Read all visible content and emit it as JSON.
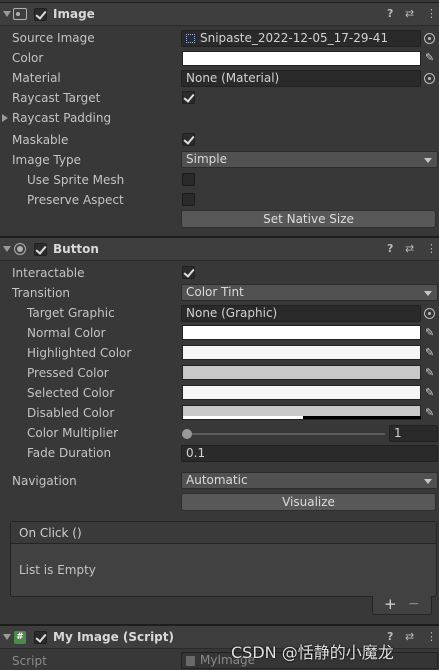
{
  "image_component": {
    "title": "Image",
    "props": {
      "source_image_label": "Source Image",
      "source_image_value": "Snipaste_2022-12-05_17-29-41",
      "color_label": "Color",
      "material_label": "Material",
      "material_value": "None (Material)",
      "raycast_target_label": "Raycast Target",
      "raycast_padding_label": "Raycast Padding",
      "maskable_label": "Maskable",
      "image_type_label": "Image Type",
      "image_type_value": "Simple",
      "use_sprite_mesh_label": "Use Sprite Mesh",
      "preserve_aspect_label": "Preserve Aspect",
      "set_native_size_label": "Set Native Size"
    },
    "raycast_target_checked": true,
    "maskable_checked": true,
    "use_sprite_mesh_checked": false,
    "preserve_aspect_checked": false,
    "color": "#ffffff"
  },
  "button_component": {
    "title": "Button",
    "props": {
      "interactable_label": "Interactable",
      "transition_label": "Transition",
      "transition_value": "Color Tint",
      "target_graphic_label": "Target Graphic",
      "target_graphic_value": "None (Graphic)",
      "normal_color_label": "Normal Color",
      "highlighted_color_label": "Highlighted Color",
      "pressed_color_label": "Pressed Color",
      "selected_color_label": "Selected Color",
      "disabled_color_label": "Disabled Color",
      "color_multiplier_label": "Color Multiplier",
      "color_multiplier_value": "1",
      "fade_duration_label": "Fade Duration",
      "fade_duration_value": "0.1",
      "navigation_label": "Navigation",
      "navigation_value": "Automatic",
      "visualize_label": "Visualize"
    },
    "interactable_checked": true,
    "colors": {
      "normal": "#ffffff",
      "highlighted": "#f5f5f5",
      "pressed": "#c8c8c8",
      "selected": "#f5f5f5",
      "disabled": "#c8c8c8"
    },
    "color_multiplier_slider_fraction": 0.0
  },
  "on_click": {
    "header": "On Click ()",
    "empty_text": "List is Empty",
    "add_label": "+",
    "remove_label": "−"
  },
  "script_component": {
    "title": "My Image (Script)",
    "script_label": "Script",
    "script_value": "MyImage"
  },
  "watermark": "CSDN @恬静的小魔龙",
  "header_icons": {
    "help": "?",
    "presets": "⇄",
    "menu": "⋮"
  }
}
